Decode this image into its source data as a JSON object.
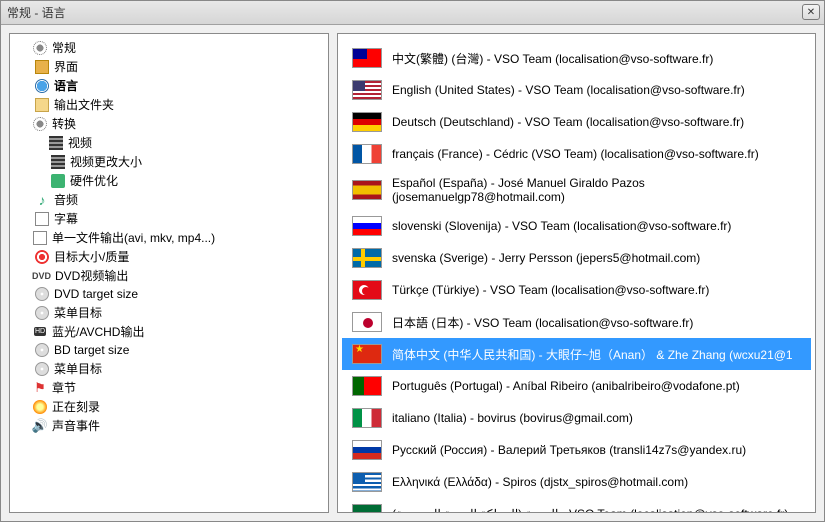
{
  "window": {
    "title": "常规 - 语言"
  },
  "tree": {
    "general": {
      "label": "常规"
    },
    "interface": {
      "label": "界面"
    },
    "language": {
      "label": "语言"
    },
    "output_folder": {
      "label": "输出文件夹"
    },
    "convert": {
      "label": "转换"
    },
    "video": {
      "label": "视频"
    },
    "video_resize": {
      "label": "视频更改大小"
    },
    "hw_optimize": {
      "label": "硬件优化"
    },
    "audio": {
      "label": "音频"
    },
    "subtitle": {
      "label": "字幕"
    },
    "single_file_output": {
      "label": "单一文件输出(avi, mkv, mp4...)"
    },
    "target_size_quality": {
      "label": "目标大小/质量"
    },
    "dvd_video_output": {
      "label": "DVD视频输出",
      "prefix": "DVD"
    },
    "dvd_target_size": {
      "label": "DVD target size"
    },
    "menu_target": {
      "label": "菜单目标"
    },
    "bluray_output": {
      "label": "蓝光/AVCHD输出",
      "prefix": "HD"
    },
    "bd_target_size": {
      "label": "BD target size"
    },
    "menu_target2": {
      "label": "菜单目标"
    },
    "chapter": {
      "label": "章节"
    },
    "burning": {
      "label": "正在刻录"
    },
    "sound_event": {
      "label": "声音事件"
    }
  },
  "languages": [
    {
      "flag": "tw",
      "text": "中文(繁體) (台灣) - VSO Team (localisation@vso-software.fr)"
    },
    {
      "flag": "us",
      "text": "English (United States) - VSO Team (localisation@vso-software.fr)"
    },
    {
      "flag": "de",
      "text": "Deutsch (Deutschland) - VSO Team (localisation@vso-software.fr)"
    },
    {
      "flag": "fr",
      "text": "français (France) - Cédric (VSO Team) (localisation@vso-software.fr)"
    },
    {
      "flag": "es",
      "text": "Español (España) - José Manuel Giraldo Pazos (josemanuelgp78@hotmail.com)"
    },
    {
      "flag": "si",
      "text": "slovenski (Slovenija) - VSO Team (localisation@vso-software.fr)"
    },
    {
      "flag": "se",
      "text": "svenska (Sverige) - Jerry Persson (jepers5@hotmail.com)"
    },
    {
      "flag": "tr",
      "text": "Türkçe (Türkiye) - VSO Team (localisation@vso-software.fr)"
    },
    {
      "flag": "jp",
      "text": "日本語 (日本) - VSO Team (localisation@vso-software.fr)"
    },
    {
      "flag": "cn",
      "text": "简体中文 (中华人民共和国) - 大眼仔~旭（Anan） & Zhe Zhang (wcxu21@1",
      "selected": true
    },
    {
      "flag": "pt",
      "text": "Português (Portugal) - Aníbal Ribeiro (anibalribeiro@vodafone.pt)"
    },
    {
      "flag": "it",
      "text": "italiano (Italia) - bovirus (bovirus@gmail.com)"
    },
    {
      "flag": "ru",
      "text": "Русский (Россия) - Валерий Третьяков (transli14z7s@yandex.ru)"
    },
    {
      "flag": "gr",
      "text": "Ελληνικά (Ελλάδα) - Spiros (djstx_spiros@hotmail.com)"
    },
    {
      "flag": "sa",
      "text": "العربية (المملكة العربية السعودية) - VSO Team (localisation@vso-software.fr)"
    }
  ]
}
